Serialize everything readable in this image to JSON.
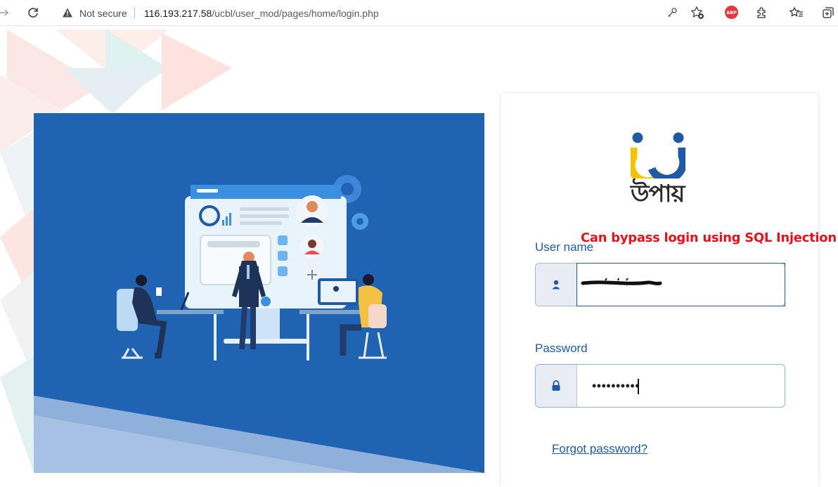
{
  "browser": {
    "not_secure": "Not secure",
    "url_host": "116.193.217.58",
    "url_path": "/ucbl/user_mod/pages/home/login.php",
    "abp_label": "ABP"
  },
  "logo": {
    "text": "উপায়"
  },
  "annotation": "Can bypass login using SQL Injection",
  "form": {
    "username_label": "User name",
    "password_label": "Password",
    "password_masked": "••••••••••",
    "forgot_link": "Forgot password?"
  },
  "colors": {
    "brand_blue": "#2163b3",
    "label_blue": "#1f5aa6",
    "logo_yellow": "#f5c400",
    "annotation_red": "#e3121b"
  }
}
